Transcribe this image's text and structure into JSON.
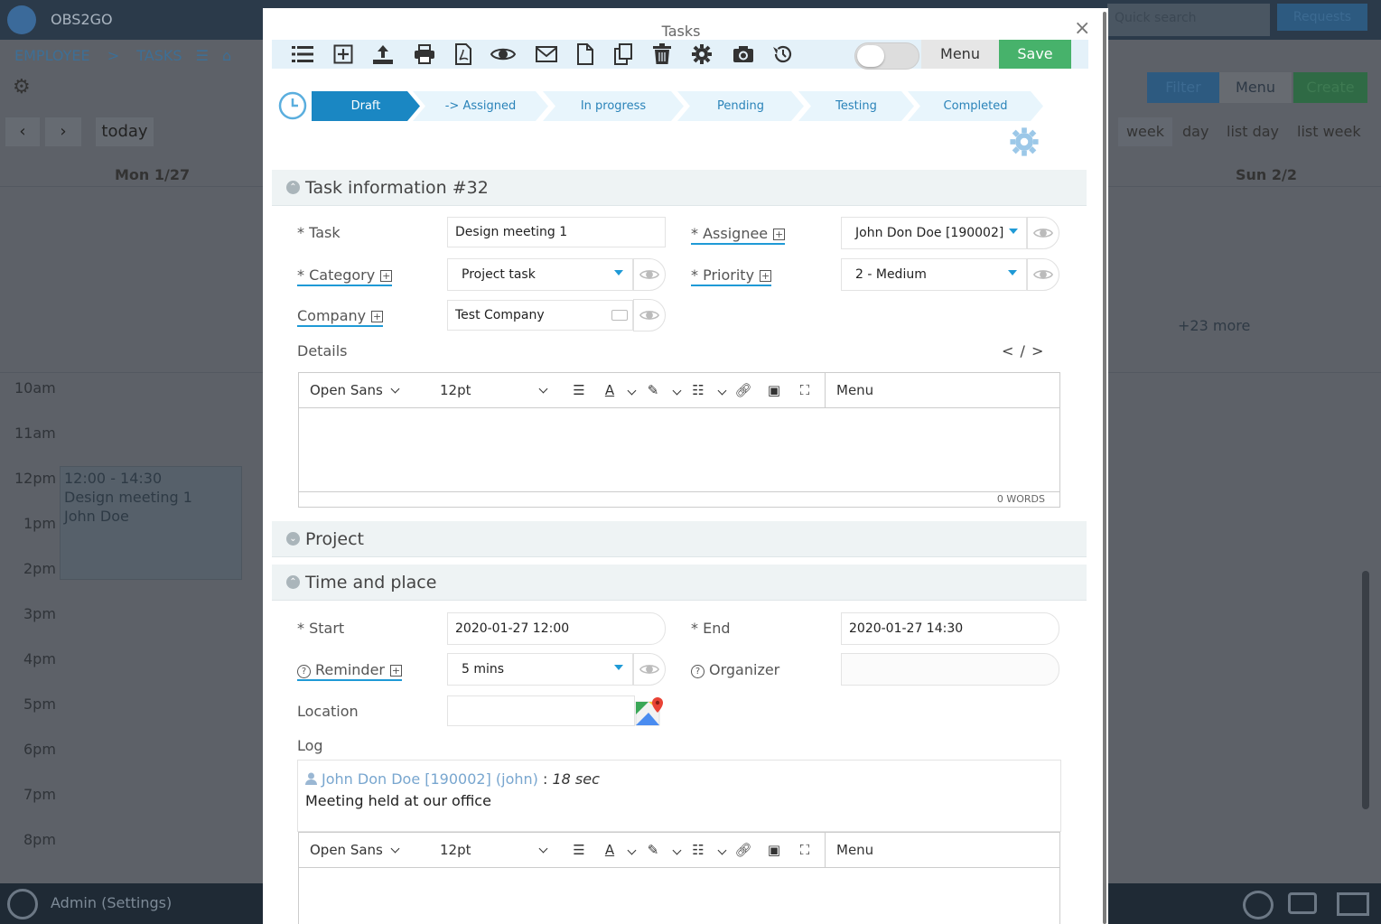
{
  "background": {
    "brand": "OBS2GO",
    "breadcrumb": [
      "EMPLOYEE",
      ">",
      "TASKS"
    ],
    "search_placeholder": "Quick search",
    "requests_label": "Requests",
    "filter_label": "Filter",
    "menu_label": "Menu",
    "create_label": "Create",
    "today_label": "today",
    "prev_label": "‹",
    "next_label": "›",
    "view_tabs": [
      "week",
      "day",
      "list day",
      "list week"
    ],
    "day_mon": "Mon 1/27",
    "day_sun": "Sun 2/2",
    "more_label": "+23 more",
    "hours": [
      "10am",
      "11am",
      "12pm",
      "1pm",
      "2pm",
      "3pm",
      "4pm",
      "5pm",
      "6pm",
      "7pm",
      "8pm"
    ],
    "event": {
      "time": "12:00 - 14:30",
      "title": "Design meeting 1",
      "person": "John Doe"
    },
    "admin_label": "Admin (Settings)"
  },
  "modal": {
    "title": "Tasks",
    "close_label": "×",
    "menu_label": "Menu",
    "save_label": "Save",
    "toolbar_icons": [
      "list-icon",
      "add-icon",
      "upload-icon",
      "print-icon",
      "pdf-icon",
      "eye-icon",
      "mail-icon",
      "document-icon",
      "copy-icon",
      "trash-icon",
      "gear-icon",
      "camera-icon",
      "history-icon"
    ],
    "workflow_steps": [
      "Draft",
      "-> Assigned",
      "In progress",
      "Pending",
      "Testing",
      "Completed"
    ],
    "active_step": "Draft",
    "accent": "#1a87c3",
    "save_color": "#47b26b"
  },
  "task_info": {
    "heading": "Task information #32",
    "task_label": "* Task",
    "task_value": "Design meeting 1",
    "assignee_label_req": "* ",
    "assignee_label": "Assignee",
    "assignee_value": "John Don Doe [190002]",
    "category_label_req": "* ",
    "category_label": "Category",
    "category_value": "Project task",
    "priority_label_req": "* ",
    "priority_label": "Priority",
    "priority_value": "2 - Medium",
    "company_label": "Company",
    "company_value": "Test Company",
    "details_label": "Details",
    "source_toggle": "< / >"
  },
  "editor": {
    "font": "Open Sans",
    "size": "12pt",
    "menu_label": "Menu",
    "word_count": "0 WORDS"
  },
  "project": {
    "heading": "Project"
  },
  "time_place": {
    "heading": "Time and place",
    "start_label": "* Start",
    "start_value": "2020-01-27 12:00",
    "end_label": "* End",
    "end_value": "2020-01-27 14:30",
    "reminder_label": "Reminder",
    "reminder_value": "5 mins",
    "organizer_label": "Organizer",
    "organizer_value": "",
    "location_label": "Location",
    "location_value": "",
    "log_label": "Log",
    "log_author": "John Don Doe [190002] (john)",
    "log_sep": " : ",
    "log_time": "18 sec",
    "log_text": "Meeting held at our office"
  }
}
